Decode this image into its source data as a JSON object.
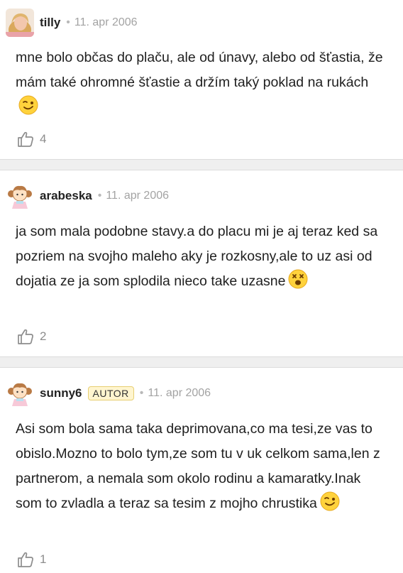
{
  "comments": [
    {
      "user": "tilly",
      "date": "11. apr 2006",
      "badge": "",
      "avatar": "photo-avatar",
      "text": "mne bolo občas do plaču, ale od únavy, alebo od šťastia, že mám také ohromné šťastie a držím taký poklad na rukách",
      "emoji": "winking-face-emoji",
      "likes": "4"
    },
    {
      "user": "arabeska",
      "date": "11. apr 2006",
      "badge": "",
      "avatar": "girl-doll-avatar",
      "text": "ja som mala podobne stavy.a do placu mi je aj teraz ked sa pozriem na svojho maleho aky je rozkosny,ale to uz asi od dojatia ze ja som splodila nieco take uzasne",
      "emoji": "dizzy-face-emoji",
      "likes": "2"
    },
    {
      "user": "sunny6",
      "date": "11. apr 2006",
      "badge": "AUTOR",
      "avatar": "girl-doll-avatar",
      "text": "Asi som bola sama taka deprimovana,co ma tesi,ze vas to obislo.Mozno to bolo tym,ze som tu v uk celkom sama,len z partnerom, a nemala som okolo rodinu a kamaratky.Inak som to zvladla a teraz sa tesim z mojho chrustika",
      "emoji": "winking-face-emoji",
      "likes": "1"
    }
  ],
  "icons": {
    "like": "thumbs-up-icon",
    "separator_dot": "•"
  },
  "colors": {
    "badge_bg": "#fff5cf",
    "badge_border": "#e7cf72",
    "meta_gray": "#a3a3a3",
    "separator": "#efefef"
  }
}
